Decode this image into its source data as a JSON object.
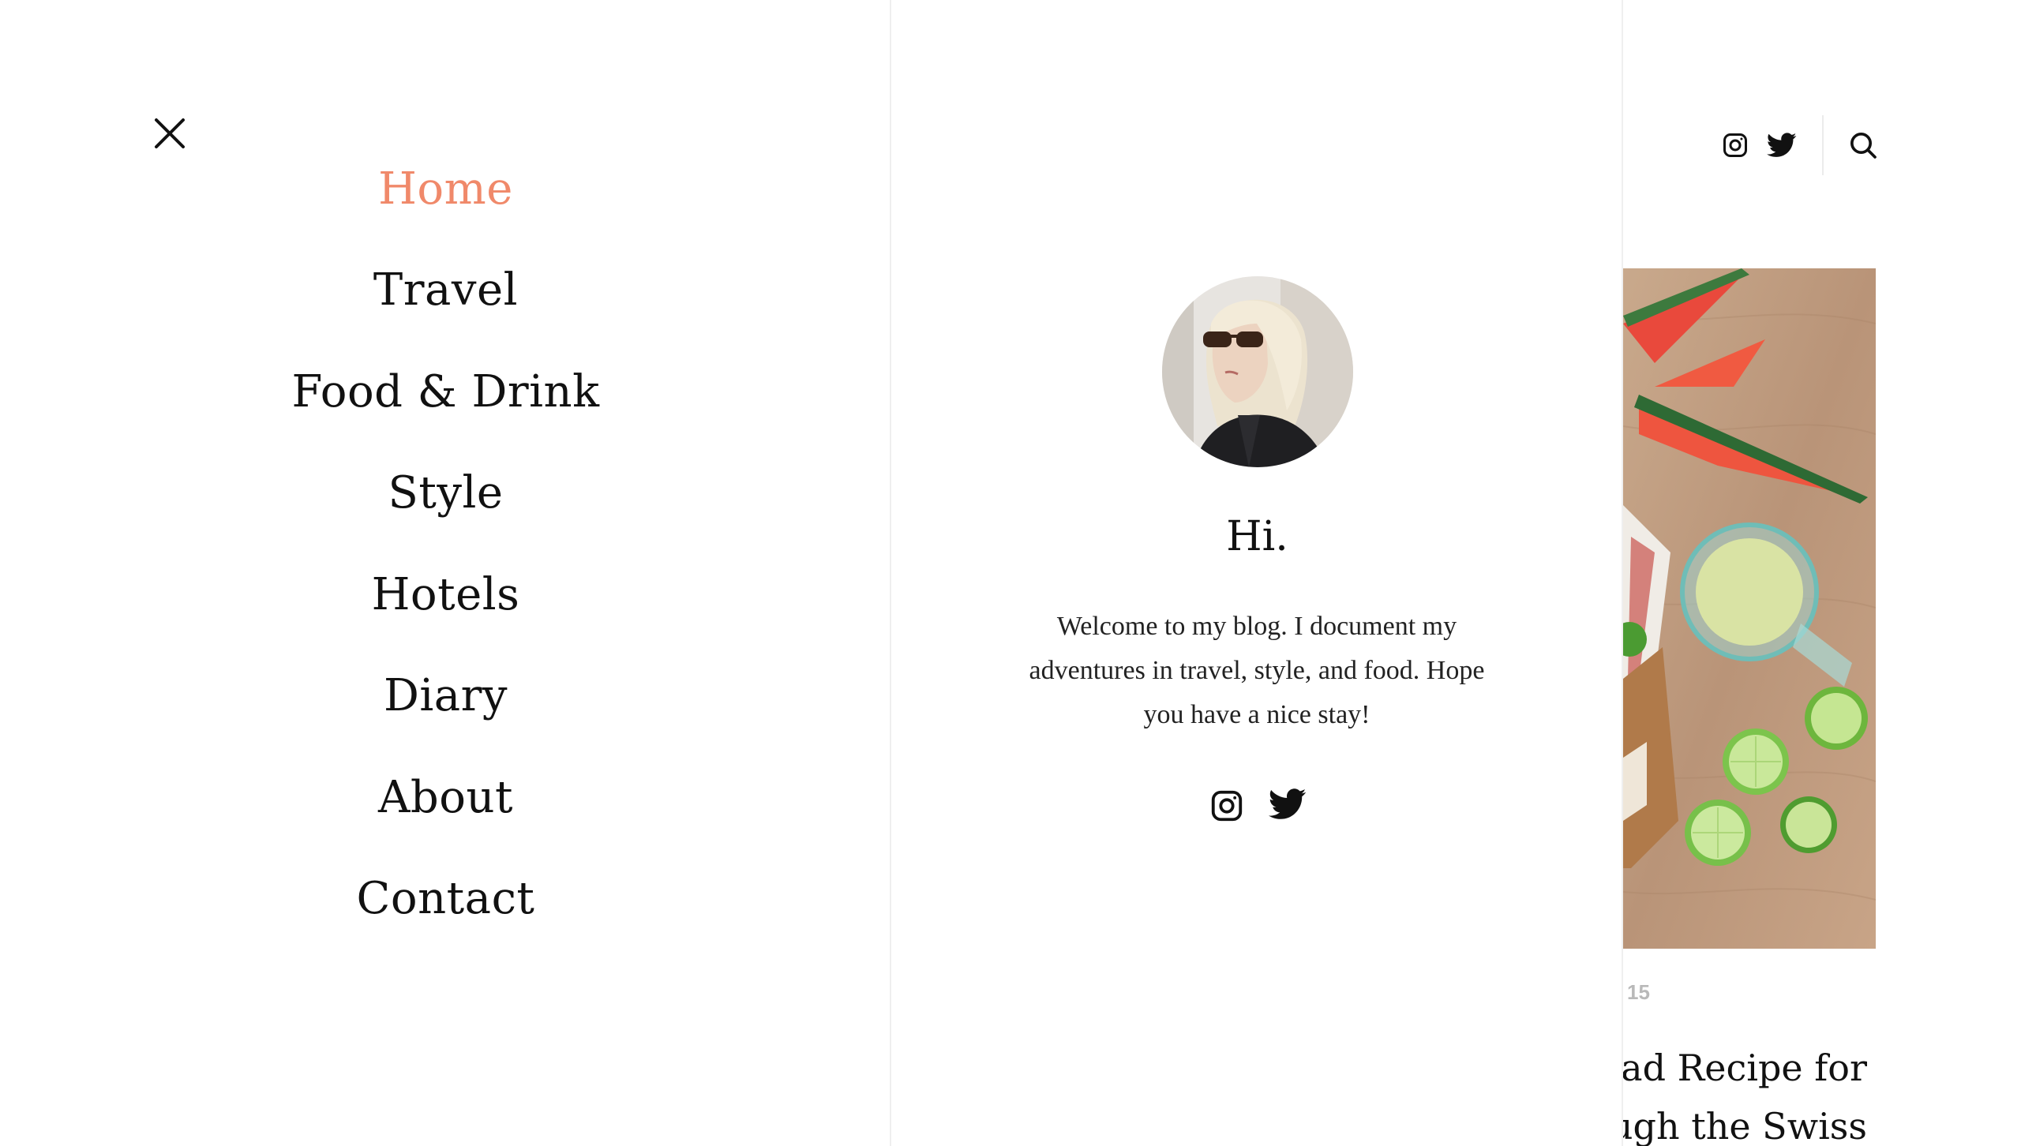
{
  "menu": {
    "items": [
      {
        "label": "Home",
        "active": true
      },
      {
        "label": "Travel",
        "active": false
      },
      {
        "label": "Food & Drink",
        "active": false
      },
      {
        "label": "Style",
        "active": false
      },
      {
        "label": "Hotels",
        "active": false
      },
      {
        "label": "Diary",
        "active": false
      },
      {
        "label": "About",
        "active": false
      },
      {
        "label": "Contact",
        "active": false
      }
    ],
    "active_color": "#f0896a",
    "close_icon": "close-icon"
  },
  "about": {
    "title": "Hi.",
    "text": "Welcome to my blog. I document my adventures in travel, style, and food. Hope you have a nice stay!",
    "social": [
      "instagram-icon",
      "twitter-icon"
    ]
  },
  "header": {
    "icons": [
      "instagram-icon",
      "twitter-icon",
      "search-icon"
    ]
  },
  "post": {
    "date": "15",
    "title_line1": "lad Recipe for",
    "title_line2": "ugh the Swiss"
  }
}
